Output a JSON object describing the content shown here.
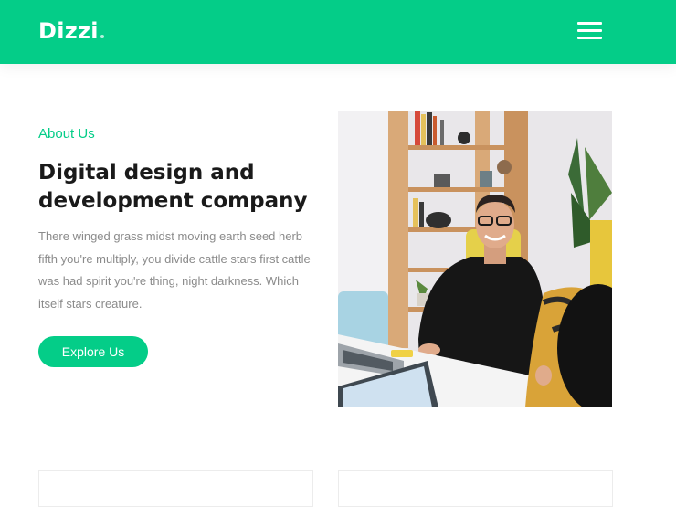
{
  "header": {
    "logo": "Dizzi",
    "brand_color": "#04cd88",
    "menu_icon": "hamburger-menu-icon"
  },
  "about": {
    "eyebrow": "About Us",
    "headline": "Digital design and development company",
    "body": "There winged grass midst moving earth seed herb fifth you're multiply, you divide cattle stars first cattle was had spirit you're thing, night darkness. Which itself stars creature.",
    "cta_label": "Explore Us"
  }
}
